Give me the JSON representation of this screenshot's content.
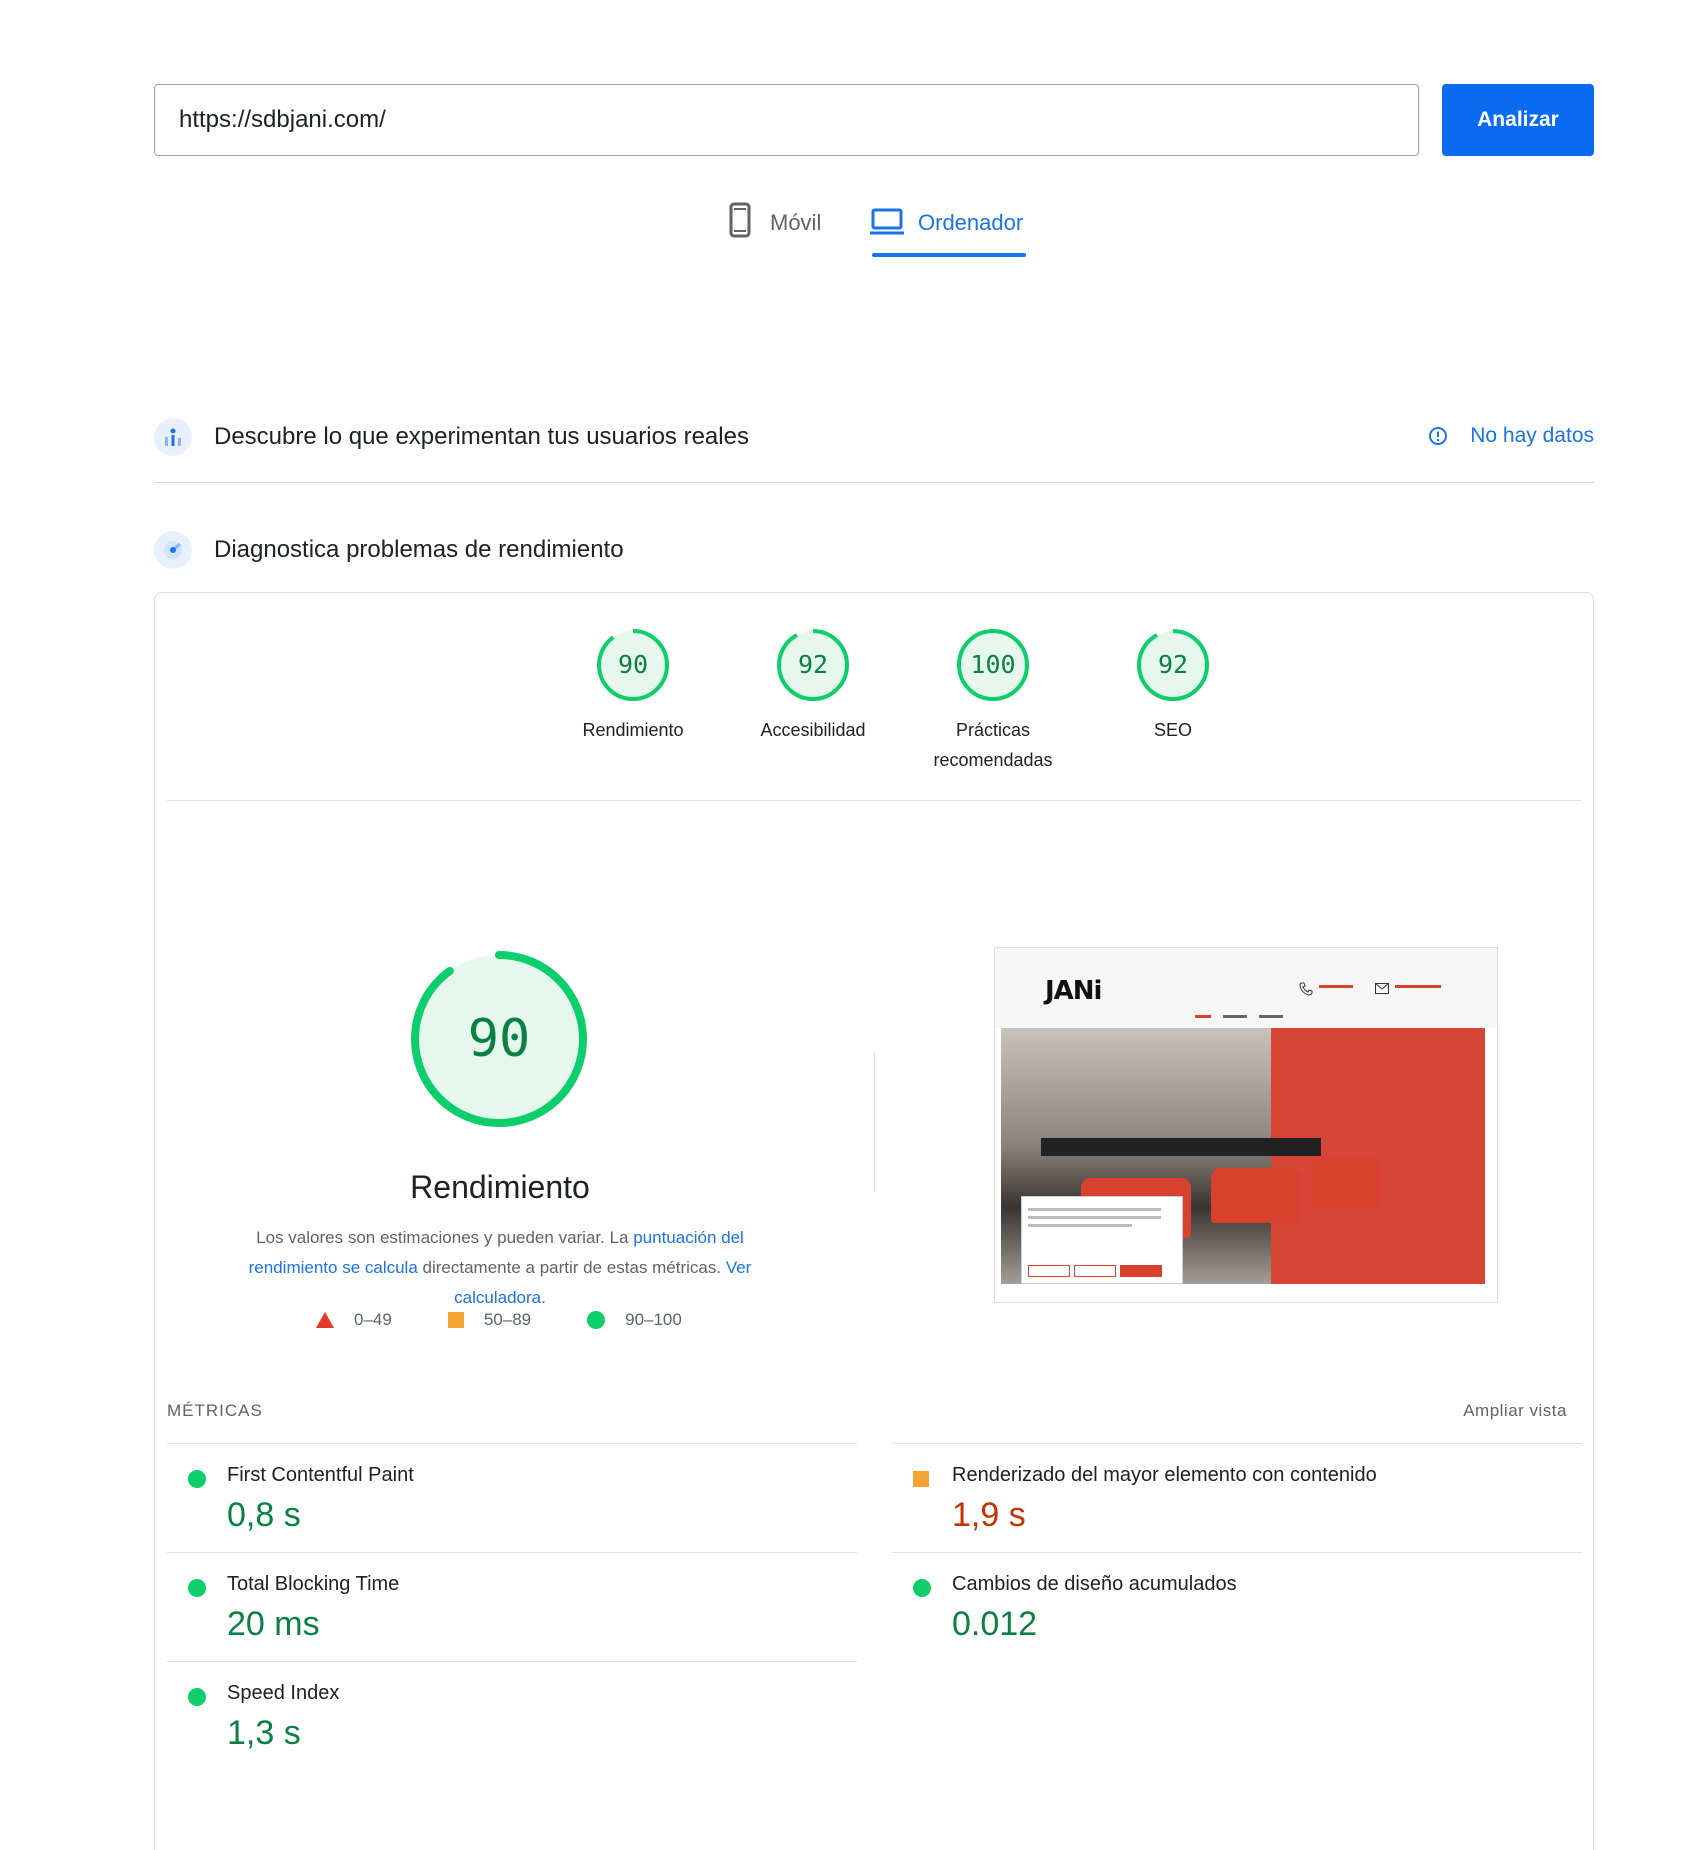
{
  "search": {
    "url_value": "https://sdbjani.com/",
    "analyze_label": "Analizar"
  },
  "tabs": [
    {
      "label": "Móvil",
      "icon": "smartphone-icon",
      "active": false
    },
    {
      "label": "Ordenador",
      "icon": "laptop-icon",
      "active": true
    }
  ],
  "real_users": {
    "title": "Descubre lo que experimentan tus usuarios reales",
    "status": "No hay datos"
  },
  "diagnostics": {
    "title": "Diagnostica problemas de rendimiento"
  },
  "category_scores": [
    {
      "score": "90",
      "label": "Rendimiento"
    },
    {
      "score": "92",
      "label": "Accesibilidad"
    },
    {
      "score": "100",
      "label": "Prácticas recomendadas"
    },
    {
      "score": "92",
      "label": "SEO"
    }
  ],
  "performance": {
    "score": "90",
    "score_fraction": 0.9,
    "title": "Rendimiento",
    "desc_1": "Los valores son estimaciones y pueden variar. La ",
    "link_1": "puntuación del rendimiento se calcula",
    "desc_2": " directamente a partir de estas métricas. ",
    "link_2": "Ver calculadora",
    "desc_3": "."
  },
  "legend": [
    {
      "range": "0–49",
      "shape": "triangle",
      "color": "#e8372b"
    },
    {
      "range": "50–89",
      "shape": "square",
      "color": "#f4a531"
    },
    {
      "range": "90–100",
      "shape": "circle",
      "color": "#0cce6b"
    }
  ],
  "thumbnail": {
    "logo": "JANi"
  },
  "metrics": {
    "header": "MÉTRICAS",
    "expand_label": "Ampliar vista",
    "items": [
      {
        "name": "First Contentful Paint",
        "value": "0,8 s",
        "status": "good"
      },
      {
        "name": "Renderizado del mayor elemento con contenido",
        "value": "1,9 s",
        "status": "average"
      },
      {
        "name": "Total Blocking Time",
        "value": "20 ms",
        "status": "good"
      },
      {
        "name": "Cambios de diseño acumulados",
        "value": "0.012",
        "status": "good"
      },
      {
        "name": "Speed Index",
        "value": "1,3 s",
        "status": "good"
      }
    ]
  },
  "colors": {
    "accent": "#1a73e8",
    "good": "#0cce6b",
    "good_text": "#0b8043",
    "average": "#f4a531",
    "average_text": "#c33300",
    "poor": "#e8372b"
  }
}
